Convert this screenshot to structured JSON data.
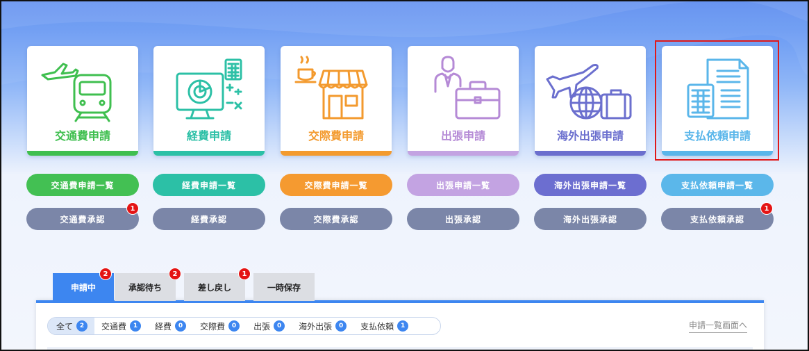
{
  "cards": [
    {
      "label": "交通費申請",
      "color": "#3fbf4f",
      "icon": "train-plane-icon"
    },
    {
      "label": "経費申請",
      "color": "#2cc0a6",
      "icon": "monitor-calculator-icon"
    },
    {
      "label": "交際費申請",
      "color": "#f39a2e",
      "icon": "shop-coffee-icon"
    },
    {
      "label": "出張申請",
      "color": "#b58ad6",
      "icon": "businessman-briefcase-icon"
    },
    {
      "label": "海外出張申請",
      "color": "#6b6fce",
      "icon": "plane-globe-suitcase-icon"
    },
    {
      "label": "支払依頼申請",
      "color": "#5ab6ea",
      "icon": "invoice-calculator-icon"
    }
  ],
  "list_buttons": [
    {
      "label": "交通費申請一覧",
      "color": "#43c053"
    },
    {
      "label": "経費申請一覧",
      "color": "#2cc0a6"
    },
    {
      "label": "交際費申請一覧",
      "color": "#f59a30"
    },
    {
      "label": "出張申請一覧",
      "color": "#c3a3e2"
    },
    {
      "label": "海外出張申請一覧",
      "color": "#6c6ed0"
    },
    {
      "label": "支払依頼申請一覧",
      "color": "#5bb7ea"
    }
  ],
  "approve_buttons": [
    {
      "label": "交通費承認",
      "badge": "1"
    },
    {
      "label": "経費承認",
      "badge": ""
    },
    {
      "label": "交際費承認",
      "badge": ""
    },
    {
      "label": "出張承認",
      "badge": ""
    },
    {
      "label": "海外出張承認",
      "badge": ""
    },
    {
      "label": "支払依頼承認",
      "badge": "1"
    }
  ],
  "approve_color": "#7b86a8",
  "tabs": [
    {
      "label": "申請中",
      "badge": "2",
      "active": true
    },
    {
      "label": "承認待ち",
      "badge": "2",
      "active": false
    },
    {
      "label": "差し戻し",
      "badge": "1",
      "active": false
    },
    {
      "label": "一時保存",
      "badge": "",
      "active": false
    }
  ],
  "filters": [
    {
      "label": "全て",
      "count": "2"
    },
    {
      "label": "交通費",
      "count": "1"
    },
    {
      "label": "経費",
      "count": "0"
    },
    {
      "label": "交際費",
      "count": "0"
    },
    {
      "label": "出張",
      "count": "0"
    },
    {
      "label": "海外出張",
      "count": "0"
    },
    {
      "label": "支払依頼",
      "count": "1"
    }
  ],
  "list_link": "申請一覧画面へ"
}
